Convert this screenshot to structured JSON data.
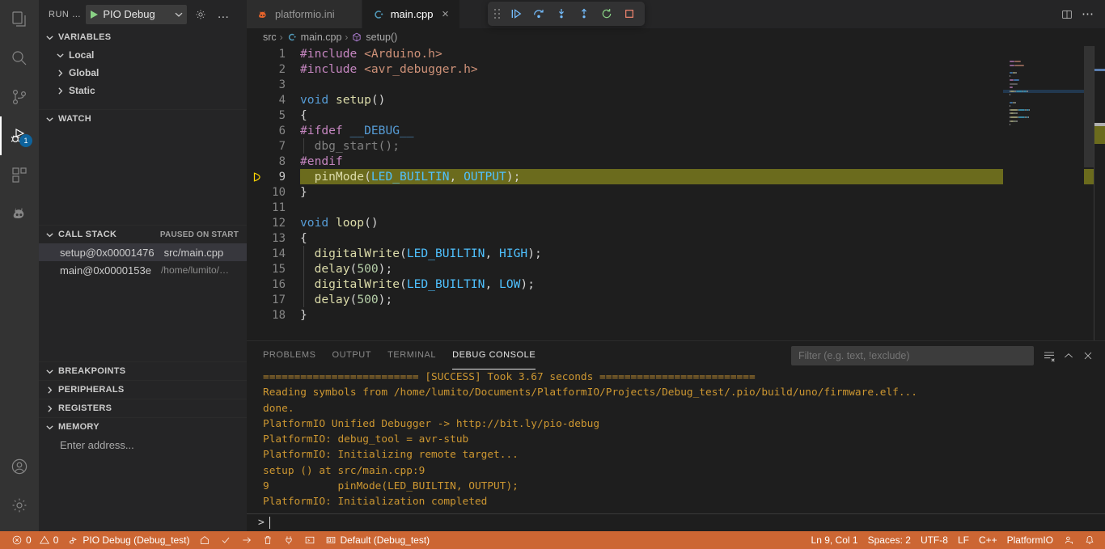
{
  "activitybar": {
    "items": [
      {
        "name": "explorer",
        "icon": "files-icon"
      },
      {
        "name": "search",
        "icon": "search-icon"
      },
      {
        "name": "source-control",
        "icon": "source-control-icon"
      },
      {
        "name": "run-and-debug",
        "icon": "debug-icon",
        "active": true,
        "badge": "1"
      },
      {
        "name": "extensions",
        "icon": "extensions-icon"
      },
      {
        "name": "platformio",
        "icon": "platformio-alien-icon"
      }
    ],
    "bottom": [
      {
        "name": "accounts",
        "icon": "account-icon"
      },
      {
        "name": "manage",
        "icon": "gear-icon"
      }
    ]
  },
  "sidebar": {
    "title": "RUN …",
    "launch_config": "PIO Debug",
    "gear_tooltip": "Open launch.json",
    "more_label": "…",
    "sections": {
      "variables": {
        "label": "VARIABLES",
        "expanded": true,
        "rows": [
          {
            "label": "Local",
            "expanded": true
          },
          {
            "label": "Global",
            "expanded": false
          },
          {
            "label": "Static",
            "expanded": false
          }
        ]
      },
      "watch": {
        "label": "WATCH",
        "expanded": true
      },
      "callstack": {
        "label": "CALL STACK",
        "status": "PAUSED ON START",
        "expanded": true,
        "frames": [
          {
            "name": "setup@0x00001476",
            "path": "src/main.cpp",
            "selected": true
          },
          {
            "name": "main@0x0000153e",
            "path": "/home/lumito/…",
            "selected": false
          }
        ]
      },
      "breakpoints": {
        "label": "BREAKPOINTS",
        "expanded": true
      },
      "peripherals": {
        "label": "PERIPHERALS",
        "expanded": false
      },
      "registers": {
        "label": "REGISTERS",
        "expanded": false
      },
      "memory": {
        "label": "MEMORY",
        "expanded": true,
        "placeholder": "Enter address..."
      }
    }
  },
  "tabs": [
    {
      "label": "platformio.ini",
      "icon": "platformio-file-icon",
      "active": false
    },
    {
      "label": "main.cpp",
      "icon": "cpp-file-icon",
      "active": true,
      "close": "×"
    }
  ],
  "tab_actions": [
    {
      "name": "split-editor-right",
      "icon": "split-editor-icon"
    },
    {
      "name": "editor-more-actions",
      "icon": "ellipsis-icon"
    }
  ],
  "debug_toolbar": {
    "buttons": [
      {
        "name": "continue",
        "icon": "continue-icon",
        "color": "#75beff"
      },
      {
        "name": "step-over",
        "icon": "step-over-icon",
        "color": "#75beff"
      },
      {
        "name": "step-into",
        "icon": "step-into-icon",
        "color": "#75beff"
      },
      {
        "name": "step-out",
        "icon": "step-out-icon",
        "color": "#75beff"
      },
      {
        "name": "restart",
        "icon": "restart-icon",
        "color": "#89d185"
      },
      {
        "name": "stop",
        "icon": "stop-icon",
        "color": "#f48771"
      }
    ]
  },
  "breadcrumb": [
    {
      "label": "src",
      "icon": null
    },
    {
      "label": "main.cpp",
      "icon": "cpp-file-icon"
    },
    {
      "label": "setup()",
      "icon": "symbol-function-icon"
    }
  ],
  "editor": {
    "language": "C++",
    "current_line": 9,
    "lines": [
      {
        "n": 1,
        "tokens": [
          {
            "t": "#include ",
            "c": "tok-pre"
          },
          {
            "t": "<Arduino.h>",
            "c": "tok-str"
          }
        ]
      },
      {
        "n": 2,
        "tokens": [
          {
            "t": "#include ",
            "c": "tok-pre"
          },
          {
            "t": "<avr_debugger.h>",
            "c": "tok-str"
          }
        ]
      },
      {
        "n": 3,
        "tokens": []
      },
      {
        "n": 4,
        "tokens": [
          {
            "t": "void ",
            "c": "tok-key"
          },
          {
            "t": "setup",
            "c": "tok-fn"
          },
          {
            "t": "()",
            "c": "tok-plain"
          }
        ]
      },
      {
        "n": 5,
        "tokens": [
          {
            "t": "{",
            "c": "tok-plain"
          }
        ]
      },
      {
        "n": 6,
        "tokens": [
          {
            "t": "#ifdef ",
            "c": "tok-pre"
          },
          {
            "t": "__DEBUG__",
            "c": "tok-macro"
          }
        ]
      },
      {
        "n": 7,
        "tokens": [
          {
            "t": "  dbg_start();",
            "c": "tok-gray"
          }
        ]
      },
      {
        "n": 8,
        "tokens": [
          {
            "t": "#endif",
            "c": "tok-pre"
          }
        ]
      },
      {
        "n": 9,
        "tokens": [
          {
            "t": "  ",
            "c": "tok-plain"
          },
          {
            "t": "pinMode",
            "c": "tok-fn"
          },
          {
            "t": "(",
            "c": "tok-plain"
          },
          {
            "t": "LED_BUILTIN",
            "c": "tok-const"
          },
          {
            "t": ", ",
            "c": "tok-plain"
          },
          {
            "t": "OUTPUT",
            "c": "tok-const"
          },
          {
            "t": ");",
            "c": "tok-plain"
          }
        ],
        "highlighted": true,
        "breakpoint_arrow": true
      },
      {
        "n": 10,
        "tokens": [
          {
            "t": "}",
            "c": "tok-plain"
          }
        ]
      },
      {
        "n": 11,
        "tokens": []
      },
      {
        "n": 12,
        "tokens": [
          {
            "t": "void ",
            "c": "tok-key"
          },
          {
            "t": "loop",
            "c": "tok-fn"
          },
          {
            "t": "()",
            "c": "tok-plain"
          }
        ]
      },
      {
        "n": 13,
        "tokens": [
          {
            "t": "{",
            "c": "tok-plain"
          }
        ]
      },
      {
        "n": 14,
        "tokens": [
          {
            "t": "  ",
            "c": "tok-plain"
          },
          {
            "t": "digitalWrite",
            "c": "tok-fn"
          },
          {
            "t": "(",
            "c": "tok-plain"
          },
          {
            "t": "LED_BUILTIN",
            "c": "tok-const"
          },
          {
            "t": ", ",
            "c": "tok-plain"
          },
          {
            "t": "HIGH",
            "c": "tok-const"
          },
          {
            "t": ");",
            "c": "tok-plain"
          }
        ]
      },
      {
        "n": 15,
        "tokens": [
          {
            "t": "  ",
            "c": "tok-plain"
          },
          {
            "t": "delay",
            "c": "tok-fn"
          },
          {
            "t": "(",
            "c": "tok-plain"
          },
          {
            "t": "500",
            "c": "tok-num"
          },
          {
            "t": ");",
            "c": "tok-plain"
          }
        ]
      },
      {
        "n": 16,
        "tokens": [
          {
            "t": "  ",
            "c": "tok-plain"
          },
          {
            "t": "digitalWrite",
            "c": "tok-fn"
          },
          {
            "t": "(",
            "c": "tok-plain"
          },
          {
            "t": "LED_BUILTIN",
            "c": "tok-const"
          },
          {
            "t": ", ",
            "c": "tok-plain"
          },
          {
            "t": "LOW",
            "c": "tok-const"
          },
          {
            "t": ");",
            "c": "tok-plain"
          }
        ]
      },
      {
        "n": 17,
        "tokens": [
          {
            "t": "  ",
            "c": "tok-plain"
          },
          {
            "t": "delay",
            "c": "tok-fn"
          },
          {
            "t": "(",
            "c": "tok-plain"
          },
          {
            "t": "500",
            "c": "tok-num"
          },
          {
            "t": ");",
            "c": "tok-plain"
          }
        ]
      },
      {
        "n": 18,
        "tokens": [
          {
            "t": "}",
            "c": "tok-plain"
          }
        ]
      }
    ]
  },
  "panel": {
    "tabs": [
      {
        "label": "PROBLEMS",
        "active": false
      },
      {
        "label": "OUTPUT",
        "active": false
      },
      {
        "label": "TERMINAL",
        "active": false
      },
      {
        "label": "DEBUG CONSOLE",
        "active": true
      }
    ],
    "filter_placeholder": "Filter (e.g. text, !exclude)",
    "actions": [
      {
        "name": "clear-console",
        "icon": "clear-all-icon"
      },
      {
        "name": "maximize-panel",
        "icon": "chevron-up-icon"
      },
      {
        "name": "close-panel",
        "icon": "close-icon"
      }
    ],
    "console_lines": [
      "========================= [SUCCESS] Took 3.67 seconds =========================",
      "Reading symbols from /home/lumito/Documents/PlatformIO/Projects/Debug_test/.pio/build/uno/firmware.elf...",
      "done.",
      "PlatformIO Unified Debugger -> http://bit.ly/pio-debug",
      "PlatformIO: debug_tool = avr-stub",
      "PlatformIO: Initializing remote target...",
      "setup () at src/main.cpp:9",
      "9           pinMode(LED_BUILTIN, OUTPUT);",
      "PlatformIO: Initialization completed"
    ],
    "prompt": ">"
  },
  "statusbar": {
    "errors": "0",
    "warnings": "0",
    "debug_session": "PIO Debug (Debug_test)",
    "pio_buttons": [
      {
        "name": "pio-home",
        "icon": "home-icon"
      },
      {
        "name": "pio-build",
        "icon": "check-icon"
      },
      {
        "name": "pio-upload",
        "icon": "arrow-right-icon"
      },
      {
        "name": "pio-clean",
        "icon": "trash-icon"
      },
      {
        "name": "pio-serial-monitor",
        "icon": "plug-icon"
      },
      {
        "name": "pio-new-terminal",
        "icon": "terminal-icon"
      }
    ],
    "environment": "Default (Debug_test)",
    "right": [
      {
        "name": "editor-position",
        "label": "Ln 9, Col 1"
      },
      {
        "name": "indentation",
        "label": "Spaces: 2"
      },
      {
        "name": "encoding",
        "label": "UTF-8"
      },
      {
        "name": "eol",
        "label": "LF"
      },
      {
        "name": "language-mode",
        "label": "C++"
      },
      {
        "name": "platformio-status",
        "label": "PlatformIO"
      }
    ],
    "right_icons": [
      {
        "name": "live-share-icon"
      },
      {
        "name": "notifications-bell-icon"
      }
    ],
    "background": "#cc6633"
  }
}
